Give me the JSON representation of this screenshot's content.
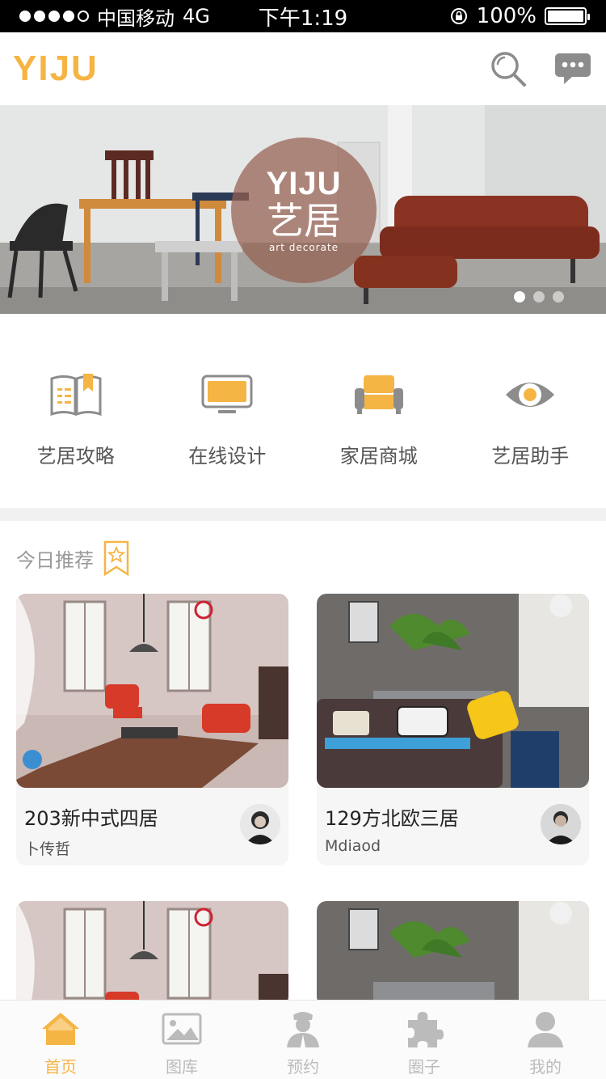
{
  "status_bar": {
    "carrier": "中国移动",
    "network": "4G",
    "time": "下午1:19",
    "battery": "100%"
  },
  "header": {
    "logo": "YIJU",
    "icons": [
      "search-icon",
      "chat-icon"
    ]
  },
  "banner": {
    "badge_en": "YIJU",
    "badge_cn": "艺居",
    "badge_sub": "art  decorate",
    "dot_count": 3,
    "active_dot": 1
  },
  "quick_nav": [
    {
      "label": "艺居攻略",
      "icon": "guide-book-icon"
    },
    {
      "label": "在线设计",
      "icon": "monitor-icon"
    },
    {
      "label": "家居商城",
      "icon": "sofa-icon"
    },
    {
      "label": "艺居助手",
      "icon": "eye-icon"
    }
  ],
  "recommend": {
    "title": "今日推荐",
    "icon": "star-bookmark-icon",
    "cards": [
      {
        "title": "203新中式四居",
        "author": "卜传哲"
      },
      {
        "title": "129方北欧三居",
        "author": "Mdiaod"
      }
    ]
  },
  "tab_bar": [
    {
      "label": "首页",
      "icon": "home-icon",
      "active": true
    },
    {
      "label": "图库",
      "icon": "gallery-icon",
      "active": false
    },
    {
      "label": "预约",
      "icon": "appointment-icon",
      "active": false
    },
    {
      "label": "圈子",
      "icon": "puzzle-icon",
      "active": false
    },
    {
      "label": "我的",
      "icon": "user-icon",
      "active": false
    }
  ],
  "colors": {
    "accent": "#f5b544",
    "icon_gray": "#8c8c8c",
    "tab_inactive": "#bbbbbb"
  }
}
